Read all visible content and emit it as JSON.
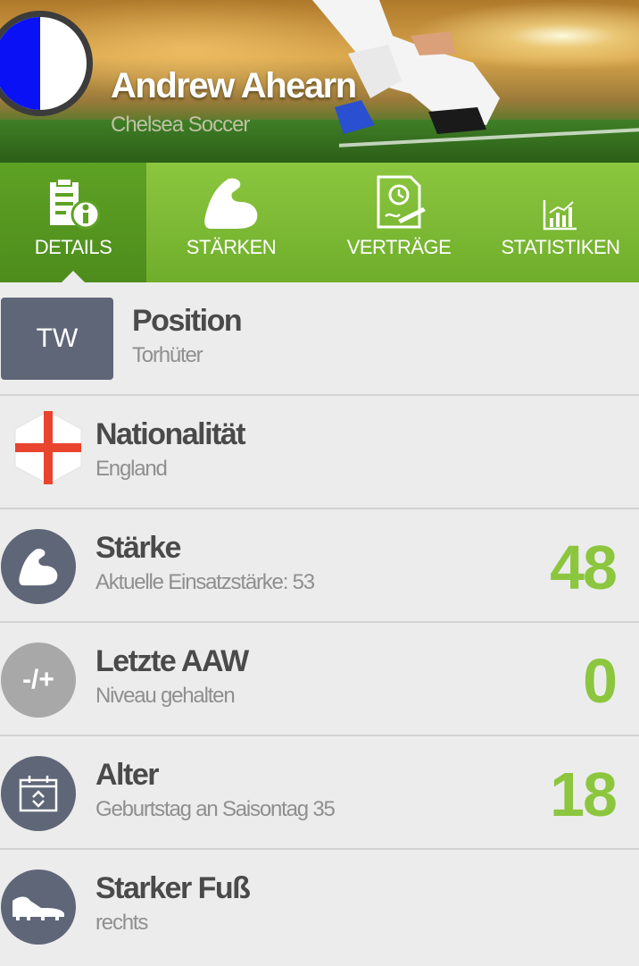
{
  "header": {
    "player_name": "Andrew Ahearn",
    "club": "Chelsea Soccer",
    "colors": {
      "avatar_left": "#0a12f5",
      "avatar_right": "#ffffff"
    }
  },
  "tabs": [
    {
      "label": "DETAILS",
      "icon": "document-info-icon",
      "active": true
    },
    {
      "label": "STÄRKEN",
      "icon": "flexed-arm-icon",
      "active": false
    },
    {
      "label": "VERTRÄGE",
      "icon": "contract-clock-icon",
      "active": false
    },
    {
      "label": "STATISTIKEN",
      "icon": "bar-chart-icon",
      "active": false
    }
  ],
  "details": {
    "position": {
      "badge": "TW",
      "title": "Position",
      "subtitle": "Torhüter"
    },
    "nationality": {
      "title": "Nationalität",
      "subtitle": "England",
      "icon": "england-flag-icon"
    },
    "strength": {
      "title": "Stärke",
      "subtitle": "Aktuelle Einsatzstärke: 53",
      "value": "48",
      "icon": "flexed-arm-icon"
    },
    "last_aaw": {
      "title": "Letzte AAW",
      "subtitle": "Niveau gehalten",
      "value": "0",
      "badge": "-/+"
    },
    "age": {
      "title": "Alter",
      "subtitle": "Geburtstag an Saisontag 35",
      "value": "18",
      "icon": "calendar-icon"
    },
    "foot": {
      "title": "Starker Fuß",
      "subtitle": "rechts",
      "icon": "football-boot-icon"
    }
  },
  "colors": {
    "accent": "#8cc63f",
    "tab_active": "#5ea224",
    "icon_bg": "#5f6678"
  }
}
